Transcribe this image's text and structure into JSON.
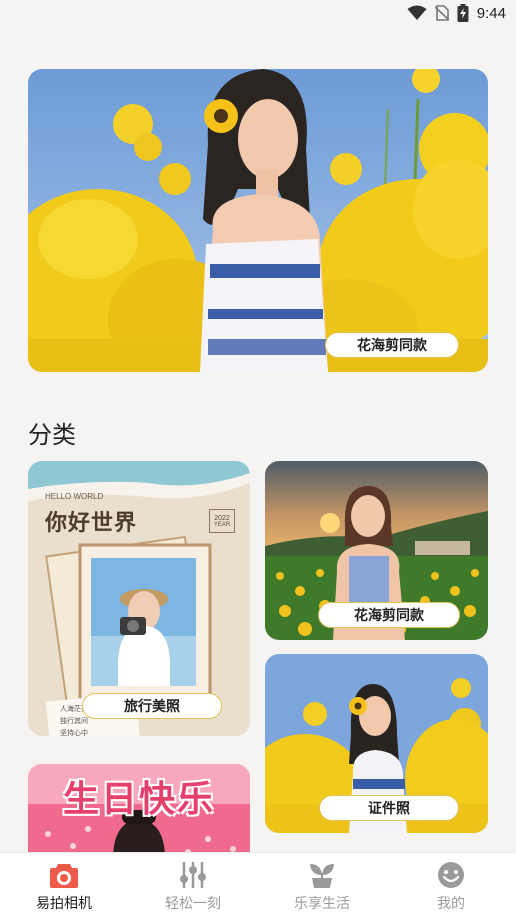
{
  "status_bar": {
    "time": "9:44"
  },
  "hero": {
    "label": "花海剪同款"
  },
  "section": {
    "title": "分类"
  },
  "cards": {
    "travel": {
      "hello": "HELLO WORLD",
      "heading": "你好世界",
      "year": "2022",
      "year_word": "YEAR",
      "label": "旅行美照"
    },
    "flower_sea": {
      "label": "花海剪同款"
    },
    "id_photo": {
      "label": "证件照"
    },
    "birthday": {
      "heading": "生日快乐"
    }
  },
  "nav": {
    "items": [
      {
        "label": "易拍相机",
        "active": true
      },
      {
        "label": "轻松一刻",
        "active": false
      },
      {
        "label": "乐享生活",
        "active": false
      },
      {
        "label": "我的",
        "active": false
      }
    ]
  },
  "colors": {
    "accent": "#ef5a4c",
    "pill_border": "#e0c35a",
    "nav_inactive": "#9a9a9a"
  }
}
